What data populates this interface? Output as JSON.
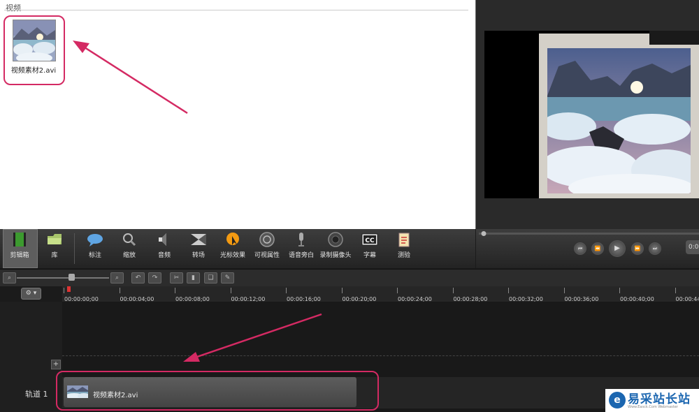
{
  "bin": {
    "title": "视频",
    "clip_name": "视频素材2.avi"
  },
  "toolbar": {
    "tools": [
      {
        "label": "剪辑箱",
        "icon": "film-icon"
      },
      {
        "label": "库",
        "icon": "library-folder-icon"
      },
      {
        "label": "标注",
        "icon": "callout-bubble-icon"
      },
      {
        "label": "缩放",
        "icon": "magnifier-icon"
      },
      {
        "label": "音频",
        "icon": "speaker-icon"
      },
      {
        "label": "转场",
        "icon": "transition-icon"
      },
      {
        "label": "光标效果",
        "icon": "cursor-effect-icon"
      },
      {
        "label": "可视属性",
        "icon": "visual-properties-icon"
      },
      {
        "label": "语音旁白",
        "icon": "microphone-icon"
      },
      {
        "label": "录制摄像头",
        "icon": "webcam-icon"
      },
      {
        "label": "字幕",
        "icon": "cc-icon"
      },
      {
        "label": "测验",
        "icon": "quiz-clipboard-icon"
      }
    ]
  },
  "preview": {
    "time_display": "0:0"
  },
  "timeline": {
    "ticks": [
      "00:00:00;00",
      "00:00:04;00",
      "00:00:08;00",
      "00:00:12;00",
      "00:00:16;00",
      "00:00:20;00",
      "00:00:24;00",
      "00:00:28;00",
      "00:00:32;00",
      "00:00:36;00",
      "00:00:40;00",
      "00:00:44;0"
    ],
    "track_name": "轨道 1",
    "clip_name": "视频素材2.avi"
  },
  "watermark": {
    "brand": "易采站长站",
    "sub": "Www.Easck.Com Webmaster"
  },
  "colors": {
    "highlight": "#d42a63",
    "brand_blue": "#1b66b0"
  }
}
